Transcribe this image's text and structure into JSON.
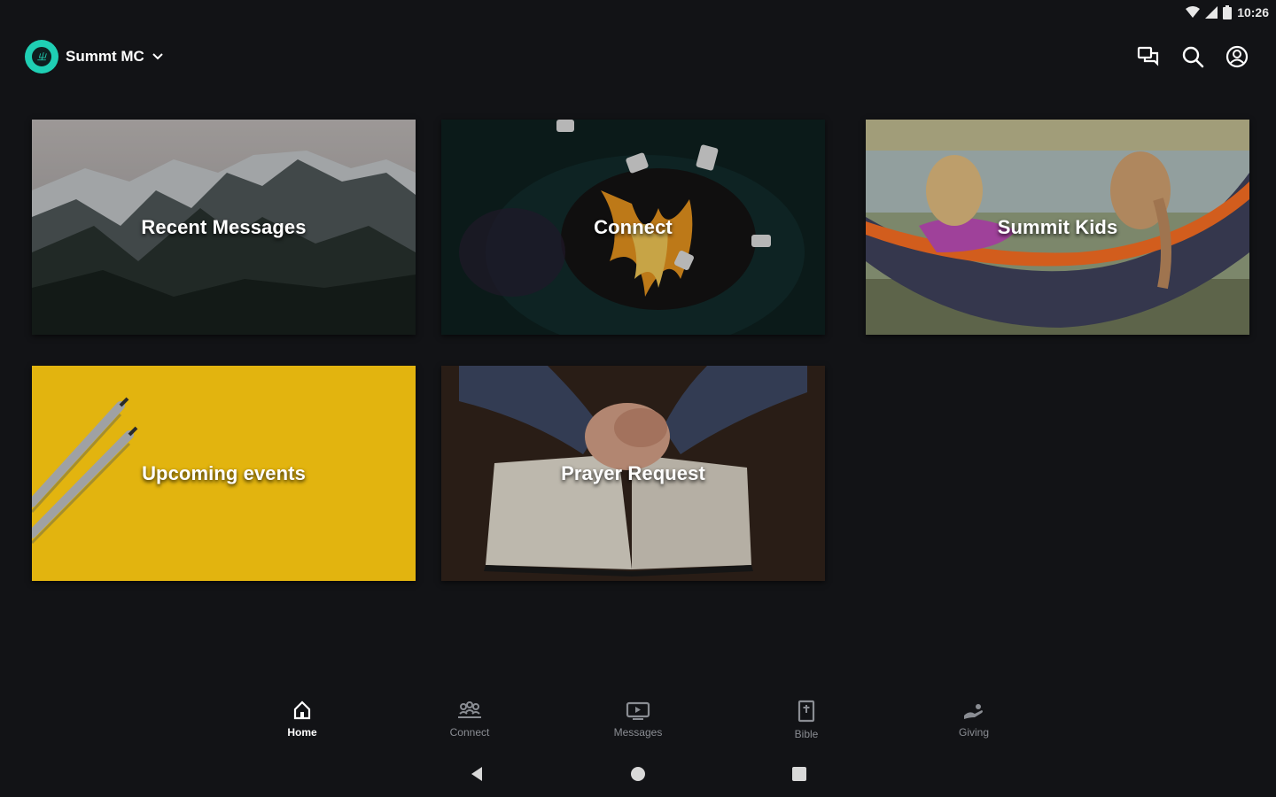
{
  "status_bar": {
    "time": "10:26"
  },
  "header": {
    "org_name": "Summt MC",
    "actions": [
      "chat-icon",
      "search-icon",
      "account-icon"
    ]
  },
  "tiles": [
    {
      "label": "Recent Messages"
    },
    {
      "label": "Connect"
    },
    {
      "label": "Summit Kids"
    },
    {
      "label": "Upcoming events"
    },
    {
      "label": "Prayer Request"
    }
  ],
  "bottom_nav": {
    "items": [
      {
        "label": "Home",
        "icon": "home-icon",
        "active": true
      },
      {
        "label": "Connect",
        "icon": "people-icon",
        "active": false
      },
      {
        "label": "Messages",
        "icon": "video-icon",
        "active": false
      },
      {
        "label": "Bible",
        "icon": "bible-icon",
        "active": false
      },
      {
        "label": "Giving",
        "icon": "giving-icon",
        "active": false
      }
    ]
  },
  "colors": {
    "background": "#121316",
    "accent": "#1fcfb4",
    "events_tile": "#e2b40f"
  }
}
